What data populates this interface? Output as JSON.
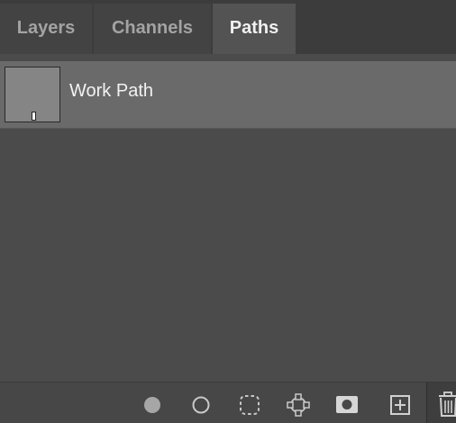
{
  "tabs": [
    {
      "label": "Layers",
      "active": false
    },
    {
      "label": "Channels",
      "active": false
    },
    {
      "label": "Paths",
      "active": true
    }
  ],
  "paths": [
    {
      "name": "Work Path",
      "selected": true
    }
  ],
  "toolbar": {
    "buttons": [
      "fill-path-icon",
      "stroke-path-icon",
      "load-selection-icon",
      "make-work-path-icon",
      "add-mask-icon",
      "new-path-icon",
      "delete-path-icon"
    ]
  },
  "colors": {
    "panel_bg": "#4b4b4b",
    "active_tab_bg": "#535353",
    "selected_row_bg": "#6a6a6a",
    "icon_color": "#c8c8c8"
  }
}
